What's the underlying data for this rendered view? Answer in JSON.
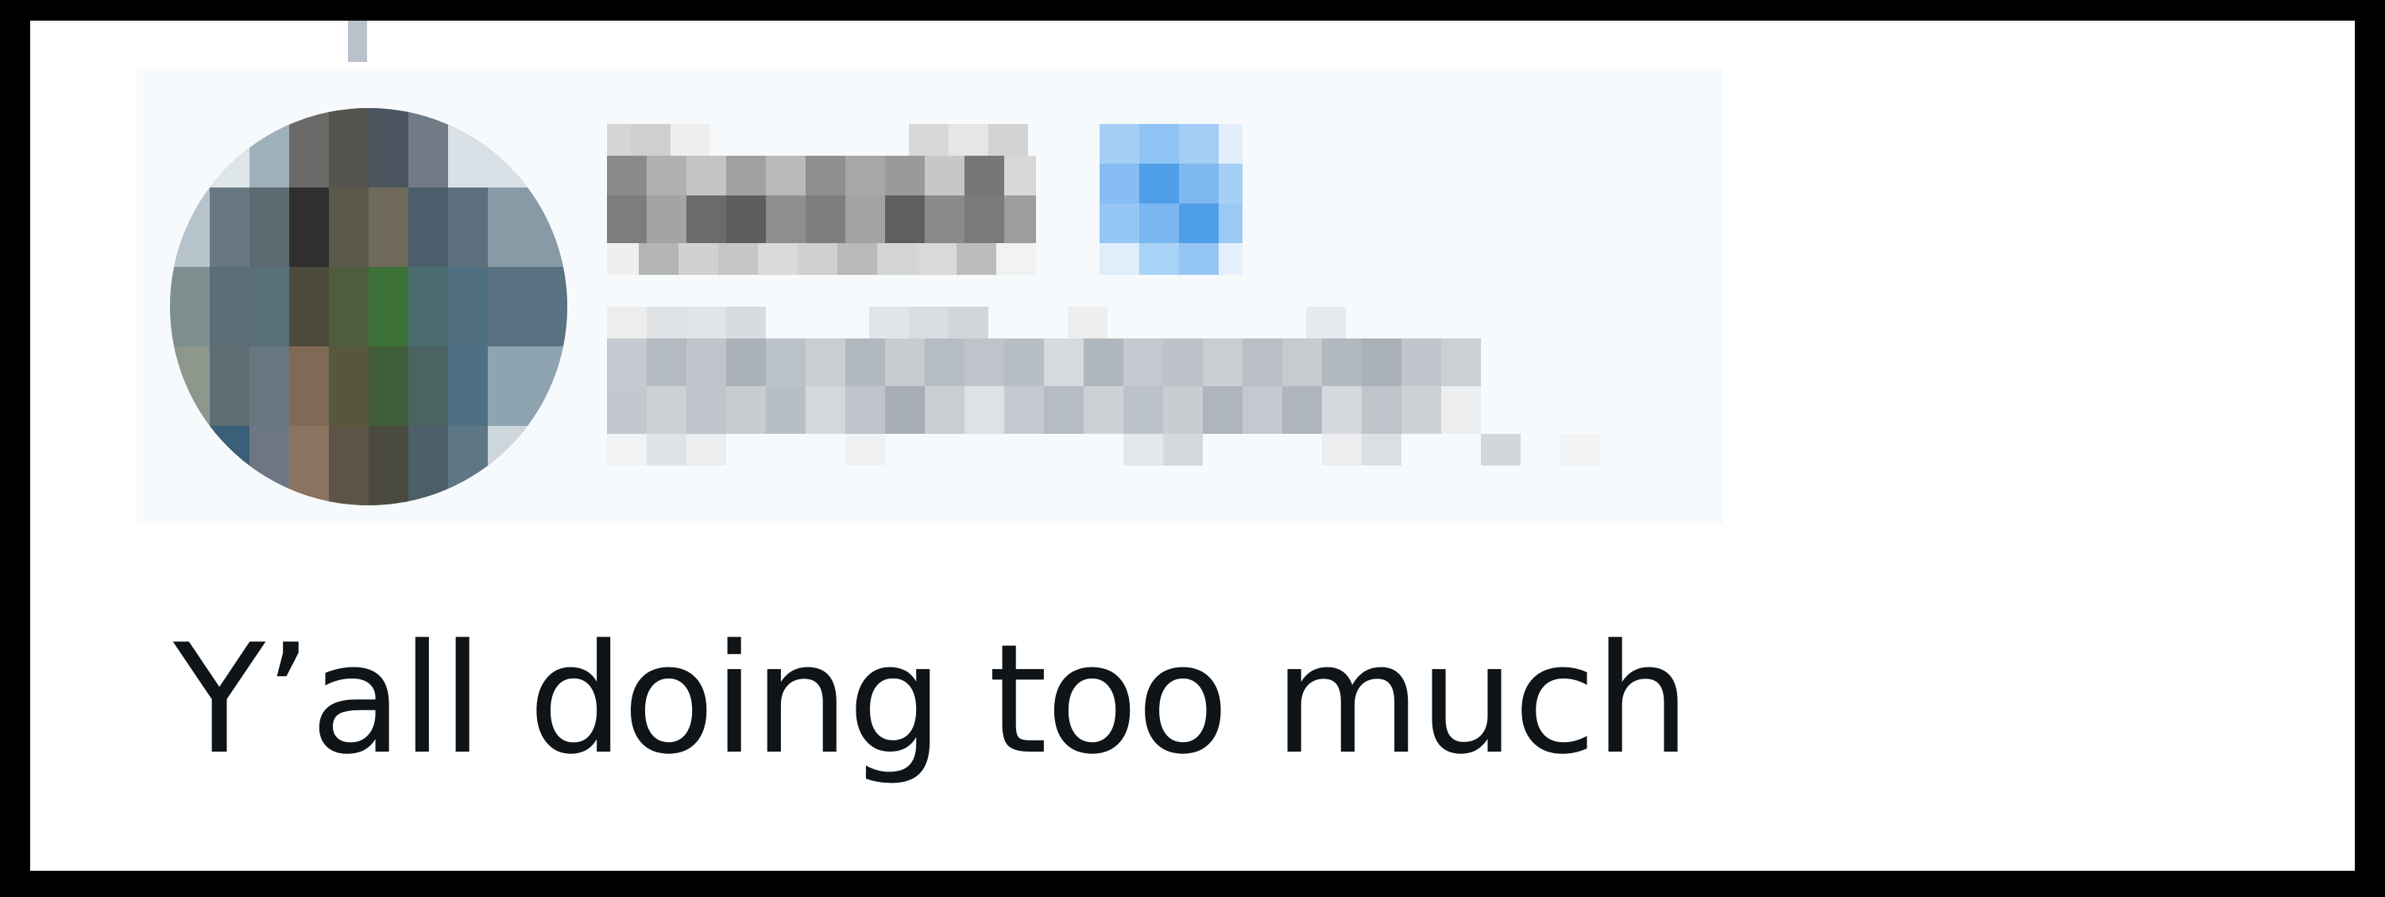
{
  "tweet": {
    "text": "Y’all doing too much"
  },
  "colors": {
    "background": "#000000",
    "card": "#ffffff",
    "text": "#0f1419",
    "verified_badge": "#1d9bf0"
  },
  "icons": {
    "verified": "verified-badge-icon"
  }
}
